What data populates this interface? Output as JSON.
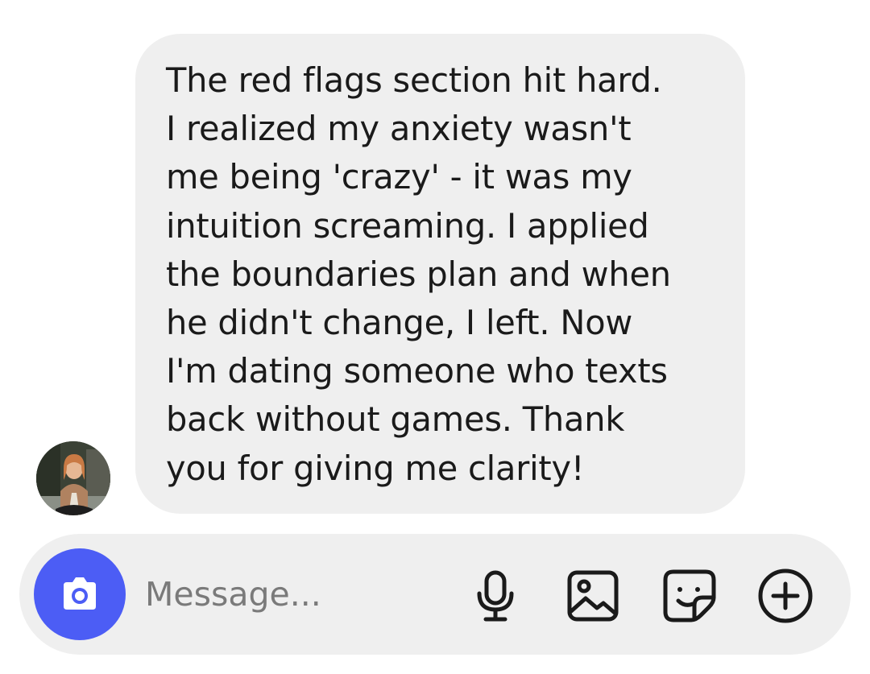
{
  "message": {
    "text": "The red flags section hit hard.\nI realized my anxiety wasn't\nme being 'crazy' - it was my\nintuition screaming. I applied\nthe boundaries plan and when\nhe didn't change, I left. Now\nI'm dating someone who texts\nback without games. Thank\nyou for giving me clarity!"
  },
  "composer": {
    "placeholder": "Message...",
    "icons": [
      "camera-icon",
      "microphone-icon",
      "image-icon",
      "sticker-icon",
      "add-icon"
    ]
  },
  "colors": {
    "bubble": "#efefef",
    "composer": "#efefef",
    "camera_button": "#4c5df5",
    "placeholder": "#7a7a7a"
  }
}
